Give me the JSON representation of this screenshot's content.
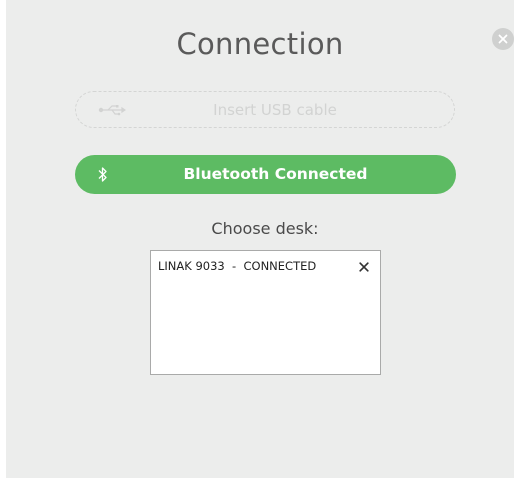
{
  "dialog": {
    "title": "Connection",
    "usb_button_label": "Insert USB cable",
    "bluetooth_button_label": "Bluetooth Connected",
    "choose_desk_label": "Choose desk:",
    "desks": [
      {
        "name": "LINAK 9033  -  CONNECTED"
      }
    ]
  },
  "colors": {
    "bluetooth_button": "#5dbb63",
    "panel_background": "#ecedec",
    "disabled_text": "#d2d3d2"
  },
  "icons": {
    "close": "close-icon",
    "usb": "usb-icon",
    "bluetooth": "bluetooth-icon",
    "remove": "remove-icon"
  }
}
